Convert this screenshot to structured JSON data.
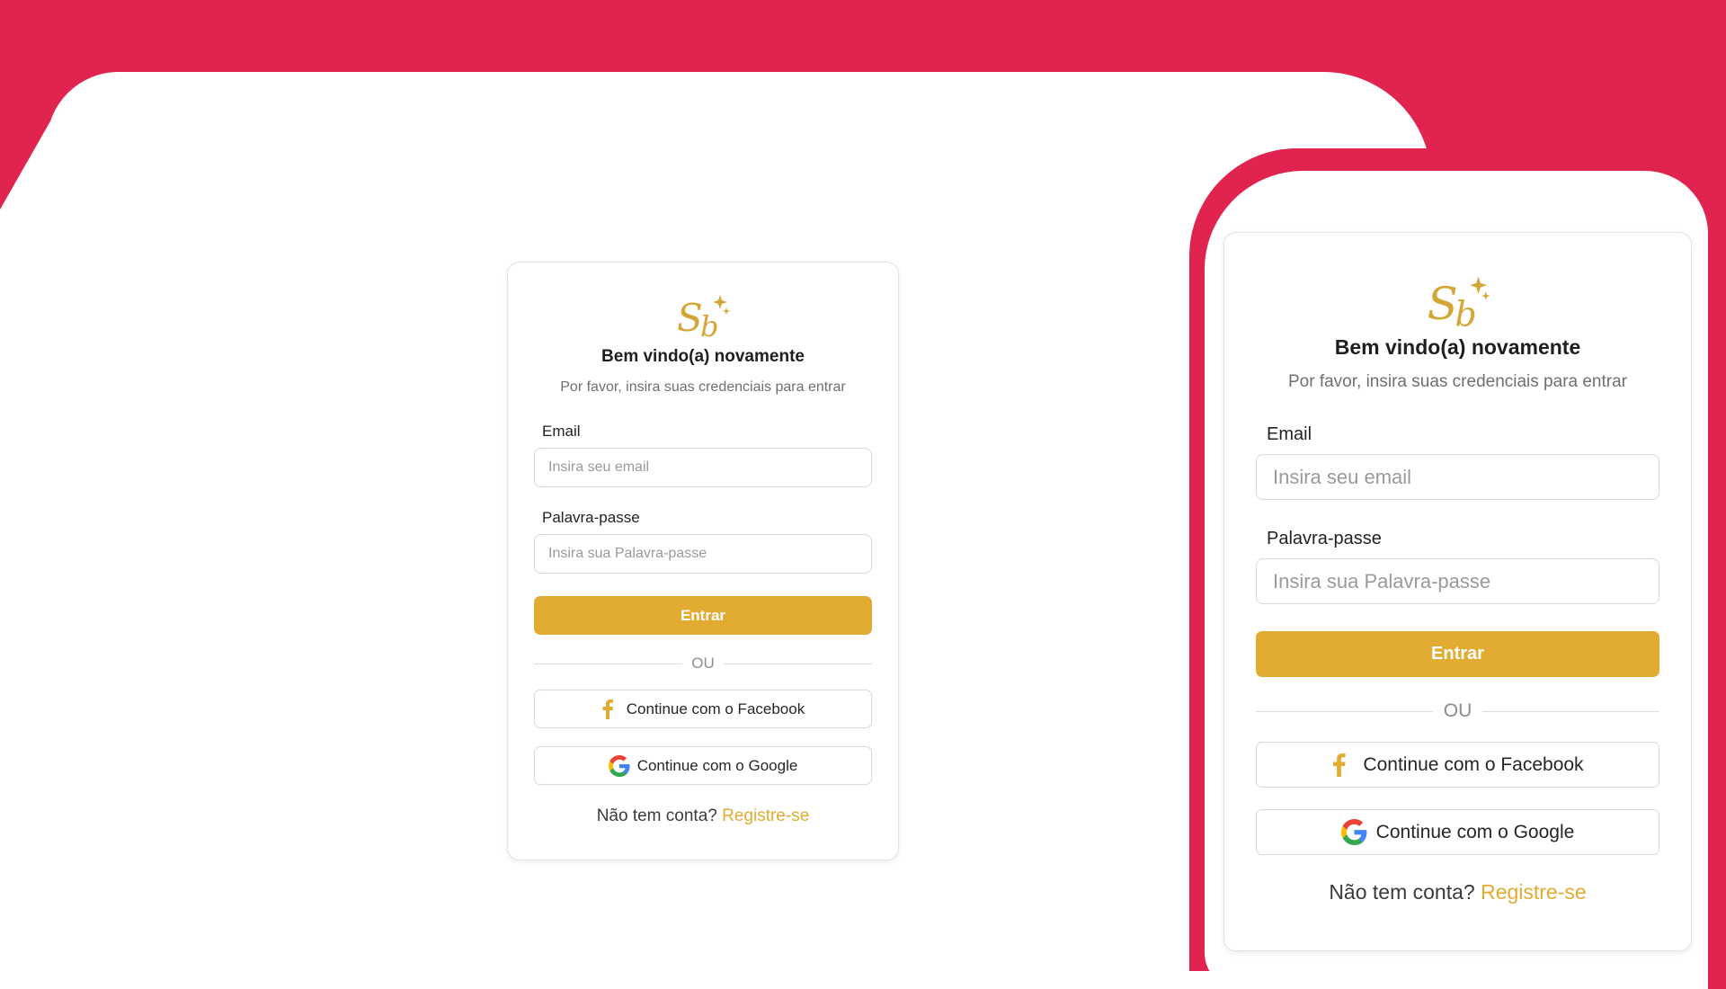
{
  "colors": {
    "background": "#e0234f",
    "accent": "#e2ab32",
    "card": "#ffffff"
  },
  "login": {
    "logo_icon": "sb-logo-icon",
    "title": "Bem vindo(a) novamente",
    "subtitle": "Por favor, insira suas credenciais para entrar",
    "email_label": "Email",
    "email_placeholder": "Insira seu email",
    "password_label": "Palavra-passe",
    "password_placeholder": "Insira sua Palavra-passe",
    "submit_label": "Entrar",
    "divider_text": "OU",
    "facebook_label": "Continue com o Facebook",
    "facebook_icon": "facebook-icon",
    "google_label": "Continue com o Google",
    "google_icon": "google-icon",
    "signup_prompt": "Não tem conta?",
    "signup_link": "Registre-se"
  }
}
